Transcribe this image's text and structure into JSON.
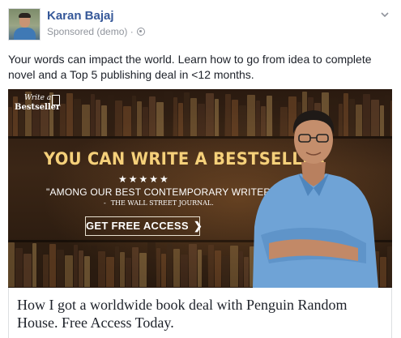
{
  "post": {
    "author": "Karan Bajaj",
    "sponsored_label": "Sponsored (demo) ·",
    "privacy_icon": "globe-icon",
    "menu_icon": "chevron-down-icon",
    "caption": "Your words can impact the world. Learn how to go from idea to complete novel and a Top 5 publishing deal in <12 months."
  },
  "ad": {
    "logo_line1": "Write a",
    "logo_line2": "Bestseller",
    "headline": "YOU CAN WRITE A BESTSELLER",
    "stars": "★★★★★",
    "quote": "\"AMONG OUR BEST CONTEMPORARY WRITERS\"",
    "source_dash": "-",
    "source": "THE WALL STREET JOURNAL.",
    "cta_label": "GET FREE ACCESS",
    "cta_arrow": "❯",
    "colors": {
      "headline": "#f5d07a",
      "background": "#2a1a10"
    }
  },
  "link": {
    "title": "How I got a worldwide book deal with Penguin Random House. Free Access Today."
  }
}
